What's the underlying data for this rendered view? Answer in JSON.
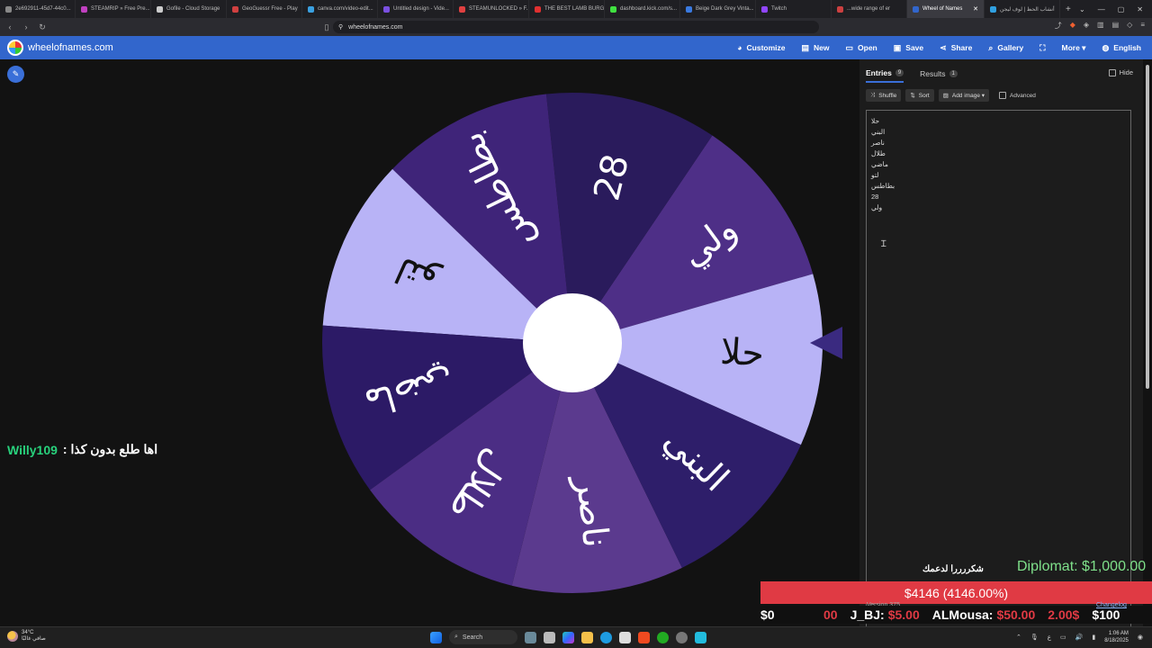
{
  "browser": {
    "tabs": [
      {
        "title": "2e692911-45d7-44c0...",
        "color": "#888888"
      },
      {
        "title": "STEAMRIP » Free Pre...",
        "color": "#c040c0"
      },
      {
        "title": "Gofile - Cloud Storage",
        "color": "#cccccc"
      },
      {
        "title": "GeoGuessr Free - Play",
        "color": "#d04040"
      },
      {
        "title": "canva.com/video-edit...",
        "color": "#3aa0e0"
      },
      {
        "title": "Untitled design - Vide...",
        "color": "#7a50e0"
      },
      {
        "title": "STEAMUNLOCKED » F...",
        "color": "#e04040"
      },
      {
        "title": "THE BEST LAMB BURG...",
        "color": "#e03030"
      },
      {
        "title": "dashboard.kick.com/s...",
        "color": "#40e040"
      },
      {
        "title": "Beige Dark Grey Vinta...",
        "color": "#3a7ae0"
      },
      {
        "title": "Twitch",
        "color": "#9146ff"
      },
      {
        "title": "...wide range of er",
        "color": "#cc4040"
      },
      {
        "title": "Wheel of Names",
        "color": "#3266cc",
        "active": true
      },
      {
        "title": "أنشاب الحظ | لوف ليجن",
        "color": "#30a0e0"
      }
    ],
    "new_tab": "+",
    "url": "wheelofnames.com"
  },
  "site": {
    "name": "wheelofnames.com",
    "menu": [
      {
        "label": "Customize",
        "icon": "palette-icon",
        "glyph": "◕"
      },
      {
        "label": "New",
        "icon": "file-icon",
        "glyph": "▤"
      },
      {
        "label": "Open",
        "icon": "folder-icon",
        "glyph": "▭"
      },
      {
        "label": "Save",
        "icon": "save-icon",
        "glyph": "▣"
      },
      {
        "label": "Share",
        "icon": "share-icon",
        "glyph": "⋖"
      },
      {
        "label": "Gallery",
        "icon": "search-icon",
        "glyph": "⌕"
      },
      {
        "label": "",
        "icon": "fullscreen-icon",
        "glyph": "⛶"
      },
      {
        "label": "More ▾",
        "icon": "more-icon",
        "glyph": ""
      },
      {
        "label": "English",
        "icon": "globe-icon",
        "glyph": "◍"
      }
    ]
  },
  "wheel": {
    "colors": [
      "#6a3aa8",
      "#3e2a8a",
      "#b9b4f8",
      "#2f1f7a",
      "#4a2582",
      "#5a3a90"
    ],
    "center_color": "#ffffff",
    "pointer_color": "#3a2a80",
    "labels": [
      "ولي",
      "28",
      "بطاطس",
      "لتو",
      "ماضي",
      "طلال",
      "ناصر",
      "البني",
      "حلا"
    ]
  },
  "chat": {
    "user": "Willy109",
    "message": "اها طلع بدون كذا :"
  },
  "panel": {
    "tabs": [
      {
        "label": "Entries",
        "count": "9"
      },
      {
        "label": "Results",
        "count": "1"
      }
    ],
    "hide_label": "Hide",
    "tools": [
      {
        "label": "Shuffle",
        "icon": "shuffle-icon",
        "glyph": "⤨"
      },
      {
        "label": "Sort",
        "icon": "sort-icon",
        "glyph": "⇅"
      },
      {
        "label": "Add image ▾",
        "icon": "image-icon",
        "glyph": "▨"
      }
    ],
    "advanced_label": "Advanced",
    "entries": [
      "حلا",
      "البني",
      "ناصر",
      "طلال",
      "ماضي",
      "لتو",
      "بطاطس",
      "28",
      "ولي"
    ]
  },
  "overlay": {
    "thanks": "شكررررا لدعمك",
    "diplomat": "Diplomat: $1,000.00",
    "goal": "$4146 (4146.00%)",
    "version": "Version 375",
    "changelog": "Changelog",
    "ticker_start": "$0",
    "ticker_items": [
      {
        "text": "00",
        "color": "red"
      },
      {
        "text": "J_BJ:",
        "color": "white"
      },
      {
        "text": "$5.00",
        "color": "red"
      },
      {
        "text": "ALMousa:",
        "color": "white"
      },
      {
        "text": "$50.00",
        "color": "red"
      },
      {
        "text": "2.00$",
        "color": "red"
      },
      {
        "text": "$100",
        "color": "white"
      }
    ]
  },
  "taskbar": {
    "weather_temp": "34°C",
    "weather_desc": "صافي غالبًا",
    "search_label": "Search",
    "time": "1:06 AM",
    "date": "8/18/2025",
    "lang": "ع"
  }
}
